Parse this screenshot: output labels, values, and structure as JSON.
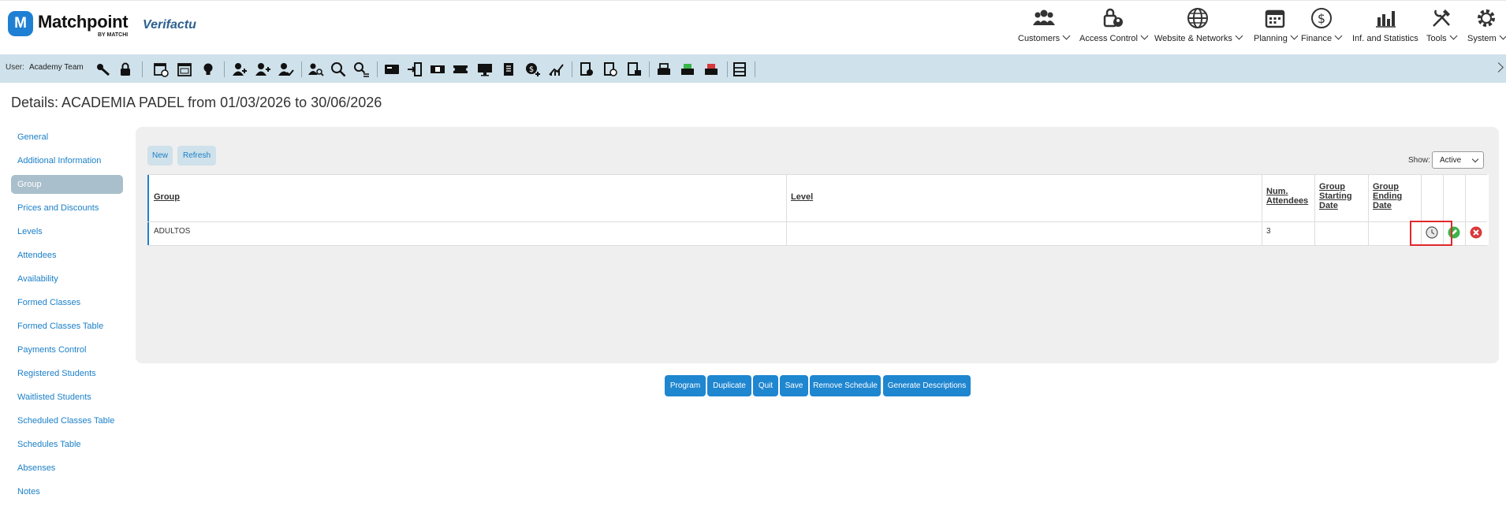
{
  "brand": {
    "logo_letter": "M",
    "name": "Matchpoint",
    "sub": "BY MATCHI",
    "partner": "Verifactu"
  },
  "top_menu": [
    {
      "label": "Customers",
      "icon": "customers-icon"
    },
    {
      "label": "Access Control",
      "icon": "access-control-icon"
    },
    {
      "label": "Website & Networks",
      "icon": "globe-icon"
    },
    {
      "label": "Planning",
      "icon": "calendar-icon"
    },
    {
      "label": "Finance",
      "icon": "dollar-icon"
    },
    {
      "label": "Inf. and Statistics",
      "icon": "bar-chart-icon"
    },
    {
      "label": "Tools",
      "icon": "tools-icon"
    },
    {
      "label": "System",
      "icon": "gear-icon"
    }
  ],
  "toolbar": {
    "user_label": "User:",
    "user_name": "Academy Team"
  },
  "page": {
    "title": "Details: ACADEMIA PADEL from 01/03/2026 to 30/06/2026"
  },
  "sidebar": {
    "items": [
      {
        "label": "General"
      },
      {
        "label": "Additional Information"
      },
      {
        "label": "Group"
      },
      {
        "label": "Prices and Discounts"
      },
      {
        "label": "Levels"
      },
      {
        "label": "Attendees"
      },
      {
        "label": "Availability"
      },
      {
        "label": "Formed Classes"
      },
      {
        "label": "Formed Classes Table"
      },
      {
        "label": "Payments Control"
      },
      {
        "label": "Registered Students"
      },
      {
        "label": "Waitlisted Students"
      },
      {
        "label": "Scheduled Classes Table"
      },
      {
        "label": "Schedules Table"
      },
      {
        "label": "Absenses"
      },
      {
        "label": "Notes"
      }
    ],
    "active_index": 2
  },
  "panel": {
    "new_label": "New",
    "refresh_label": "Refresh",
    "show_label": "Show:",
    "show_value": "Active"
  },
  "table": {
    "headers": {
      "group": "Group",
      "level": "Level",
      "num_attendees_1": "Num.",
      "num_attendees_2": "Attendees",
      "start_1": "Group",
      "start_2": "Starting",
      "start_3": "Date",
      "end_1": "Group",
      "end_2": "Ending",
      "end_3": "Date"
    },
    "rows": [
      {
        "group": "ADULTOS",
        "level": "",
        "num_attendees": "3",
        "start": "",
        "end": ""
      }
    ]
  },
  "footer_buttons": {
    "program": "Program",
    "duplicate": "Duplicate",
    "quit": "Quit",
    "save": "Save",
    "remove_schedule": "Remove Schedule",
    "generate_descriptions": "Generate Descriptions"
  },
  "colors": {
    "brand_blue": "#1f7fd3",
    "toolbar_bg": "#cfe1ea",
    "highlight": "#e0282c",
    "ok_green": "#3bb54a",
    "delete_red": "#d9383a"
  }
}
